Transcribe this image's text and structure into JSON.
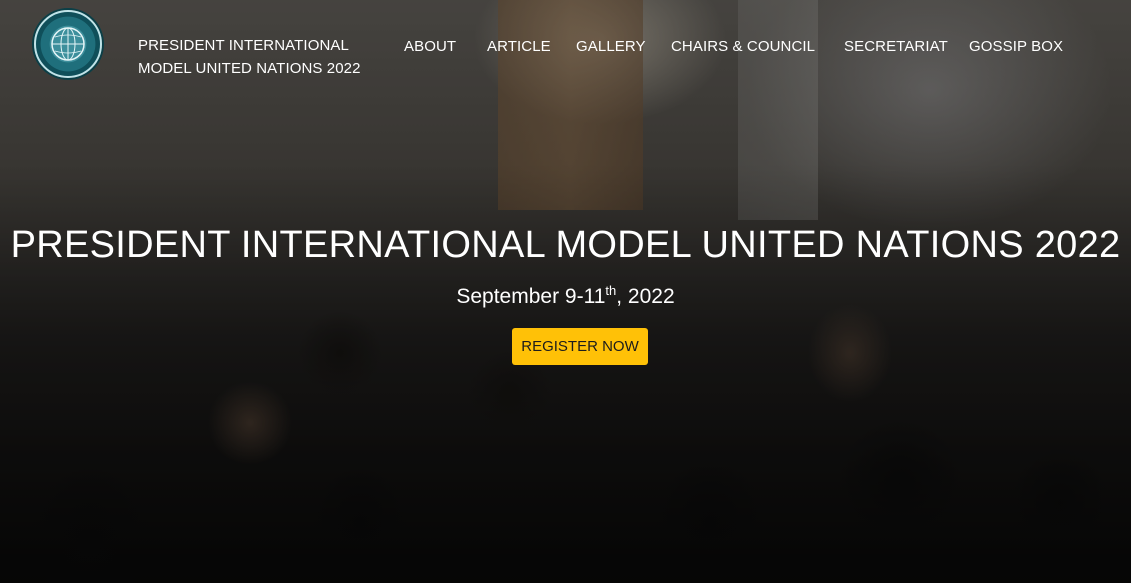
{
  "header": {
    "logo_icon": "globe-emblem-icon",
    "brand_line1": "PRESIDENT INTERNATIONAL",
    "brand_line2": "MODEL UNITED NATIONS 2022",
    "nav": [
      {
        "label": "ABOUT"
      },
      {
        "label": "ARTICLE"
      },
      {
        "label": "GALLERY"
      },
      {
        "label": "CHAIRS & COUNCIL"
      },
      {
        "label": "SECRETARIAT"
      },
      {
        "label": "GOSSIP BOX"
      }
    ]
  },
  "hero": {
    "title": "PRESIDENT INTERNATIONAL MODEL UNITED NATIONS 2022",
    "date_prefix": "September 9-11",
    "date_sup": "th",
    "date_suffix": ", 2022",
    "cta_label": "REGISTER NOW"
  },
  "colors": {
    "accent": "#ffc107",
    "text": "#ffffff",
    "logo_teal": "#1f6f7c"
  }
}
